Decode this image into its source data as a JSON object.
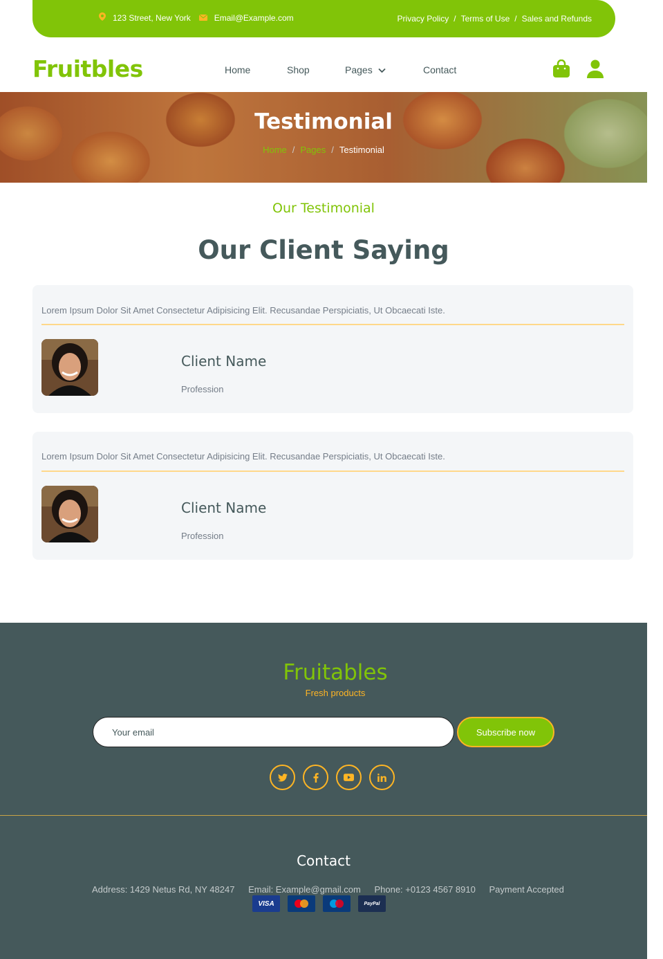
{
  "topbar": {
    "address": "123 Street, New York",
    "email": "Email@Example.com",
    "links": [
      "Privacy Policy",
      "Terms of Use",
      "Sales and Refunds"
    ],
    "separator": "/"
  },
  "brand": {
    "logo": "Fruitbles"
  },
  "nav": {
    "items": [
      "Home",
      "Shop",
      "Pages",
      "Contact"
    ],
    "icons": [
      "shopping-bag-icon",
      "user-icon"
    ]
  },
  "hero": {
    "title": "Testimonial",
    "breadcrumb": [
      "Home",
      "Pages",
      "Testimonial"
    ],
    "separator": "/"
  },
  "section": {
    "eyebrow": "Our Testimonial",
    "title": "Our Client Saying"
  },
  "testimonials": [
    {
      "quote": "Lorem Ipsum Dolor Sit Amet Consectetur Adipisicing Elit. Recusandae Perspiciatis, Ut Obcaecati Iste.",
      "name": "Client Name",
      "profession": "Profession"
    },
    {
      "quote": "Lorem Ipsum Dolor Sit Amet Consectetur Adipisicing Elit. Recusandae Perspiciatis, Ut Obcaecati Iste.",
      "name": "Client Name",
      "profession": "Profession"
    }
  ],
  "footer": {
    "brand": "Fruitables",
    "tagline": "Fresh products",
    "email_placeholder": "Your email",
    "subscribe_label": "Subscribe now",
    "social": [
      {
        "icon": "twitter-icon",
        "glyph": "t"
      },
      {
        "icon": "facebook-icon",
        "glyph": "f"
      },
      {
        "icon": "youtube-icon",
        "glyph": "▶"
      },
      {
        "icon": "linkedin-icon",
        "glyph": "in"
      }
    ],
    "contact_title": "Contact",
    "address": "Address: 1429 Netus Rd, NY 48247",
    "email": "Email: Example@gmail.com",
    "phone": "Phone: +0123 4567 8910",
    "payment": "Payment Accepted",
    "payment_cards": [
      {
        "name": "VISA",
        "color": "#1a3c8f"
      },
      {
        "name": "MasterCard",
        "color": "#0a3a7a"
      },
      {
        "name": "Maestro",
        "color": "#0a3a7a"
      },
      {
        "name": "PayPal",
        "color": "#1c2f52"
      }
    ]
  },
  "colors": {
    "primary": "#81c408",
    "secondary": "#ffb524",
    "dark": "#45595b"
  }
}
